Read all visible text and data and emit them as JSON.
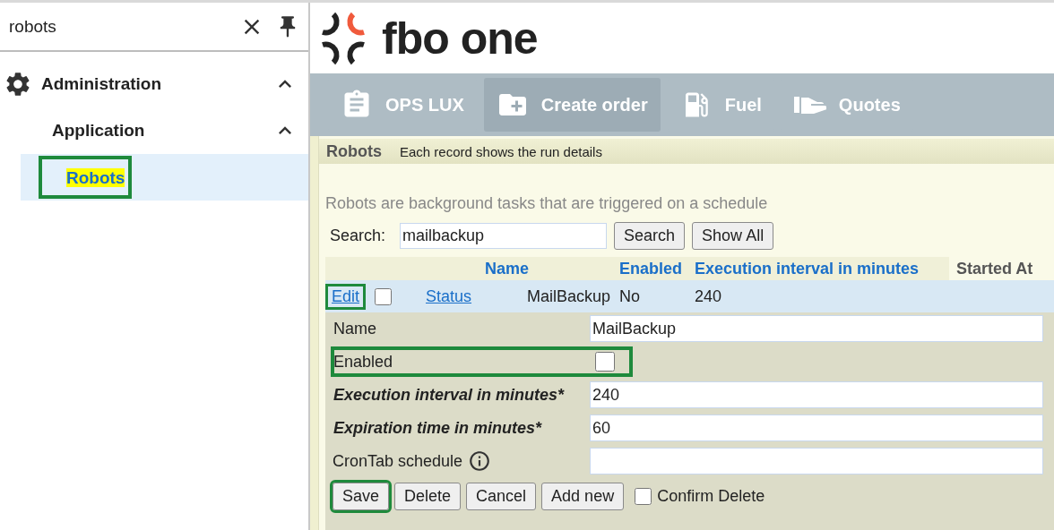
{
  "sidebar": {
    "search": {
      "value": "robots"
    },
    "tree": [
      {
        "label": "Administration",
        "expanded": true,
        "children": [
          {
            "label": "Application",
            "expanded": true,
            "children": [
              {
                "label": "Robots",
                "selected": true,
                "highlighted": true
              }
            ]
          }
        ]
      }
    ]
  },
  "header": {
    "logo_text": "fbo one"
  },
  "nav": [
    {
      "label": "OPS LUX",
      "kind": "clipboard",
      "selected": false
    },
    {
      "label": "Create order",
      "kind": "folder",
      "selected": true
    },
    {
      "label": "Fuel",
      "kind": "fuel",
      "selected": false
    },
    {
      "label": "Quotes",
      "kind": "hand",
      "selected": false
    }
  ],
  "panel": {
    "title": "Robots",
    "subtitle": "Each record shows the run details",
    "description": "Robots are background tasks that are triggered on a schedule",
    "search": {
      "label": "Search:",
      "value": "mailbackup"
    },
    "buttons": [
      "Search",
      "Show All"
    ]
  },
  "table": {
    "columns": [
      {
        "label": "Name",
        "kind": "link"
      },
      {
        "label": "Enabled",
        "kind": "link"
      },
      {
        "label": "Execution interval in minutes",
        "kind": "link"
      },
      {
        "label": "Started At",
        "kind": "plain"
      }
    ],
    "rows": [
      {
        "edit": "Edit",
        "edit_highlighted": true,
        "checked": false,
        "status": "Status",
        "name": "MailBackup",
        "enabled": "No",
        "interval": "240",
        "editing": true
      }
    ]
  },
  "form": {
    "fields": [
      {
        "kind": "text",
        "label": "Name",
        "value": "MailBackup",
        "required": false
      },
      {
        "kind": "checkbox",
        "label": "Enabled",
        "checked": false,
        "highlighted": true
      },
      {
        "kind": "text",
        "label": "Execution interval in minutes*",
        "value": "240",
        "required": true
      },
      {
        "kind": "text",
        "label": "Expiration time in minutes*",
        "value": "60",
        "required": true
      },
      {
        "kind": "text",
        "label": "CronTab schedule",
        "required": false,
        "info": true
      }
    ],
    "buttons": [
      {
        "label": "Save",
        "highlighted": true
      },
      {
        "label": "Delete",
        "highlighted": false
      },
      {
        "label": "Cancel",
        "highlighted": false
      },
      {
        "label": "Add new",
        "highlighted": false
      }
    ],
    "confirm": {
      "label": "Confirm Delete",
      "checked": false
    }
  }
}
